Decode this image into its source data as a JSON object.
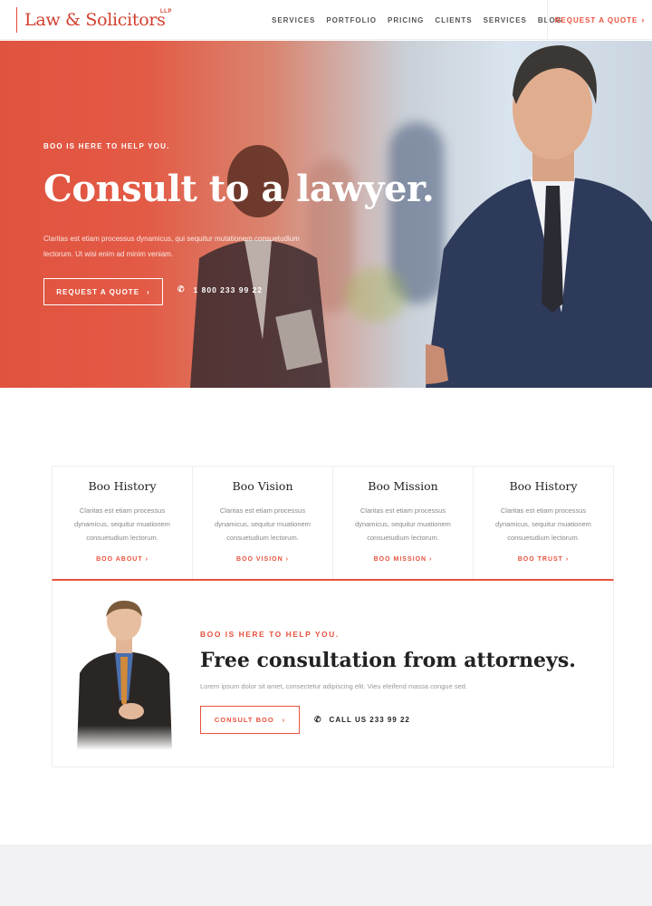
{
  "header": {
    "logo": "Law & Solicitors",
    "logo_sup": "LLP",
    "nav": [
      "SERVICES",
      "PORTFOLIO",
      "PRICING",
      "CLIENTS",
      "SERVICES",
      "BLOG"
    ],
    "cta": "REQUEST A QUOTE",
    "cta_icon": "chevron-right-icon"
  },
  "hero": {
    "eyebrow": "BOO IS HERE TO HELP YOU.",
    "title": "Consult to a lawyer.",
    "description_line1": "Claritas est etiam processus dynamicus, qui sequitur mutationem consuetudium",
    "description_line2": "lectorum. Ut wisi enim ad minim veniam.",
    "button": "REQUEST A QUOTE",
    "phone": "1 800 233 99 22",
    "phone_icon": "phone-icon",
    "gradient_color": "#e0533f"
  },
  "features": [
    {
      "title": "Boo History",
      "text": "Claritas est etiam processus dynamicus, sequitur muationem consuetudium lectorum.",
      "link": "BOO ABOUT"
    },
    {
      "title": "Boo Vision",
      "text": "Claritas est etiam processus dynamicus, sequitur muationem consuetudium lectorum.",
      "link": "BOO VISION"
    },
    {
      "title": "Boo Mission",
      "text": "Claritas est etiam processus dynamicus, sequitur muationem consuetudium lectorum.",
      "link": "BOO MISSION"
    },
    {
      "title": "Boo History",
      "text": "Claritas est etiam processus dynamicus, sequitur muationem consuetudium lectorum.",
      "link": "BOO TRUST"
    }
  ],
  "consult": {
    "eyebrow": "BOO IS HERE TO HELP YOU.",
    "title": "Free consultation from attorneys.",
    "description": "Lorem ipsum dolor sit amet, consectetur adipiscing elit. Vieu eleifend massa congue sed.",
    "button": "CONSULT BOO",
    "phone": "CALL US 233 99 22"
  },
  "colors": {
    "accent": "#e8523d",
    "footer_band": "#f2f2f4"
  }
}
